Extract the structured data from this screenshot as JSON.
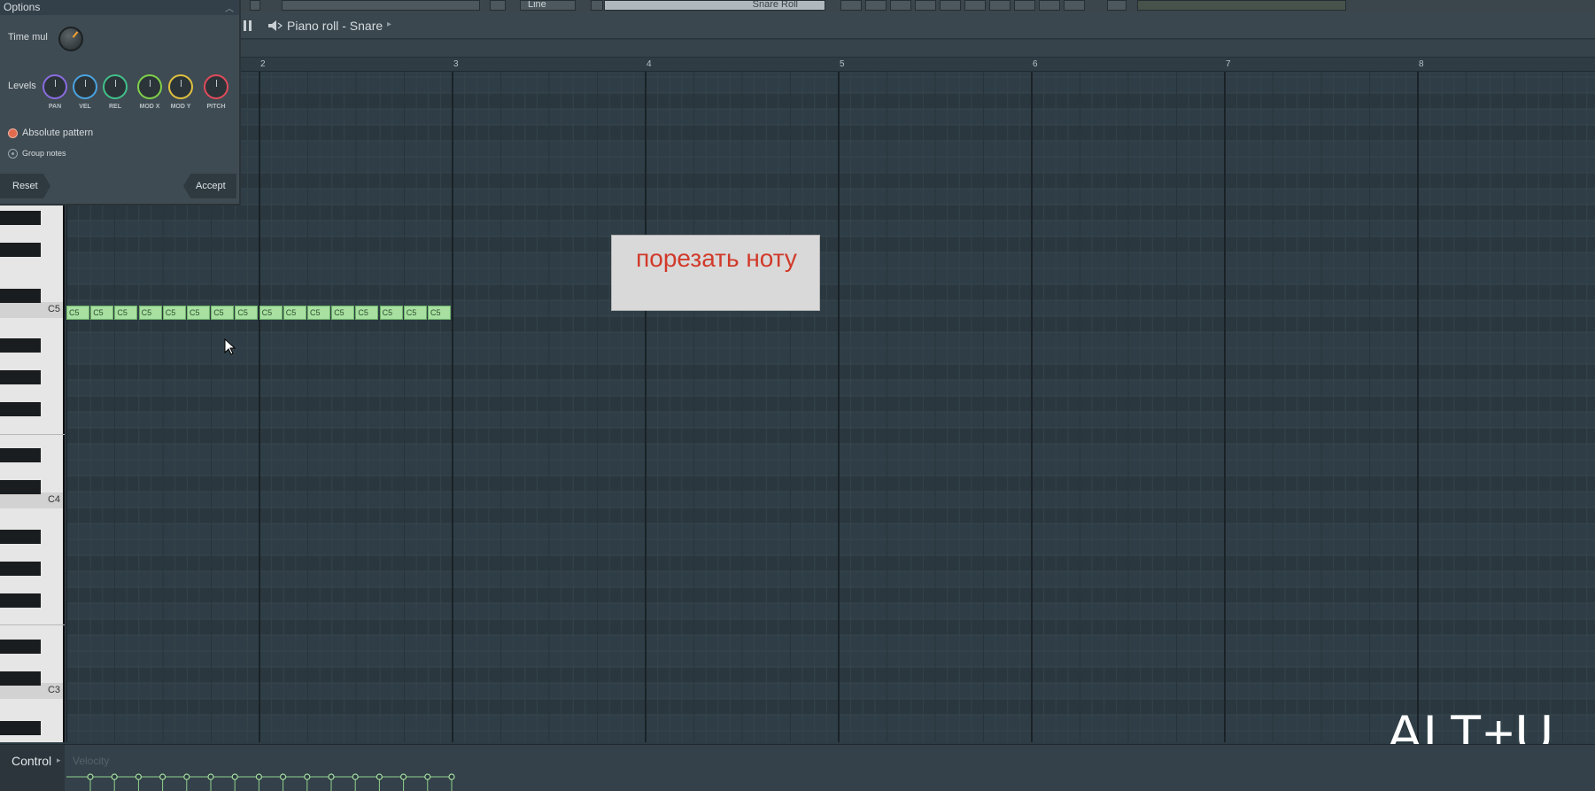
{
  "toolbar": {
    "line_mode": "Line",
    "pattern_selector": "Snare Roll"
  },
  "window": {
    "title": "Piano roll - Snare"
  },
  "ruler": {
    "bars": [
      "2",
      "3",
      "4",
      "5",
      "6",
      "7",
      "8"
    ]
  },
  "options_panel": {
    "title": "Options",
    "time_mul_label": "Time mul",
    "levels_label": "Levels",
    "knobs": [
      {
        "label": "PAN",
        "color": "#8a6be0"
      },
      {
        "label": "VEL",
        "color": "#4aa3e0"
      },
      {
        "label": "REL",
        "color": "#41c08a"
      },
      {
        "label": "MOD X",
        "color": "#7fd04a"
      },
      {
        "label": "MOD Y",
        "color": "#e0c040"
      },
      {
        "label": "PITCH",
        "color": "#e04a5a"
      }
    ],
    "absolute_pattern_label": "Absolute pattern",
    "absolute_pattern_checked": true,
    "group_notes_label": "Group notes",
    "group_notes_checked": false,
    "reset_label": "Reset",
    "accept_label": "Accept"
  },
  "keyboard": {
    "octave_labels": [
      "C5",
      "C4",
      "C3"
    ]
  },
  "notes": {
    "label": "C5",
    "count": 16
  },
  "hint": {
    "text": "порезать ноту"
  },
  "shortcut": {
    "text": "ALT+U"
  },
  "control": {
    "label": "Control",
    "lane": "Velocity"
  },
  "colors": {
    "note_fill": "#a7e0a1",
    "grid_bg": "#2f3e46",
    "hint_text": "#d13a2a"
  }
}
